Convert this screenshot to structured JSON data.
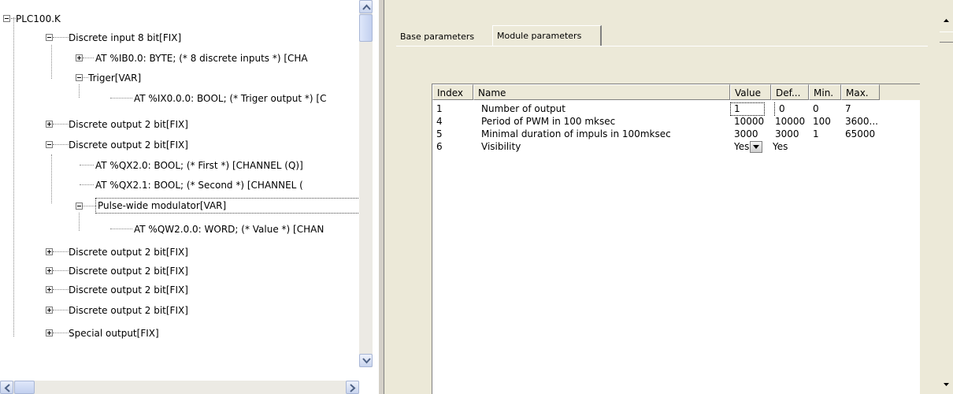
{
  "tree": {
    "root": "PLC100.K",
    "discrete_input": "Discrete input 8 bit[FIX]",
    "ib_byte": "AT %IB0.0: BYTE; (* 8 discrete inputs *) [CHA",
    "triger": "Triger[VAR]",
    "ix_bool": "AT %IX0.0.0: BOOL; (* Triger output *) [C",
    "discrete_output_collapsed_1": "Discrete output 2 bit[FIX]",
    "discrete_output_expanded": "Discrete output 2 bit[FIX]",
    "qx_first": "AT %QX2.0: BOOL; (* First *) [CHANNEL (Q)]",
    "qx_second": "AT %QX2.1: BOOL; (* Second *) [CHANNEL (",
    "pwm": "Pulse-wide modulator[VAR]",
    "qw_word": "AT %QW2.0.0: WORD; (* Value *) [CHAN",
    "discrete_output_collapsed_2": "Discrete output 2 bit[FIX]",
    "discrete_output_collapsed_3": "Discrete output 2 bit[FIX]",
    "discrete_output_collapsed_4": "Discrete output 2 bit[FIX]",
    "discrete_output_collapsed_5": "Discrete output 2 bit[FIX]",
    "special_output": "Special output[FIX]"
  },
  "tabs": {
    "base": "Base parameters",
    "module": "Module parameters",
    "active": "Module parameters"
  },
  "grid": {
    "headers": {
      "index": "Index",
      "name": "Name",
      "value": "Value",
      "def": "Def...",
      "min": "Min.",
      "max": "Max."
    },
    "rows": [
      {
        "index": "1",
        "name": "Number of output",
        "value": "1",
        "def": "0",
        "min": "0",
        "max": "7"
      },
      {
        "index": "4",
        "name": "Period of PWM in 100 mksec",
        "value": "10000",
        "def": "10000",
        "min": "100",
        "max": "3600..."
      },
      {
        "index": "5",
        "name": "Minimal duration of impuls in 100mksec",
        "value": "3000",
        "def": "3000",
        "min": "1",
        "max": "65000"
      },
      {
        "index": "6",
        "name": "Visibility",
        "value": "Yes",
        "def": "Yes",
        "min": "",
        "max": ""
      }
    ]
  },
  "icons": {
    "expand": "plus-box-icon",
    "collapse": "minus-box-icon",
    "scroll_up": "arrow-up-icon",
    "scroll_down": "arrow-down-icon",
    "scroll_left": "arrow-left-icon",
    "scroll_right": "arrow-right-icon",
    "combo": "dropdown-arrow-icon"
  },
  "colors": {
    "panel_bg": "#ece9d8",
    "scrollbar_accent": "#c2d0ef",
    "tree_lines": "#888888"
  }
}
